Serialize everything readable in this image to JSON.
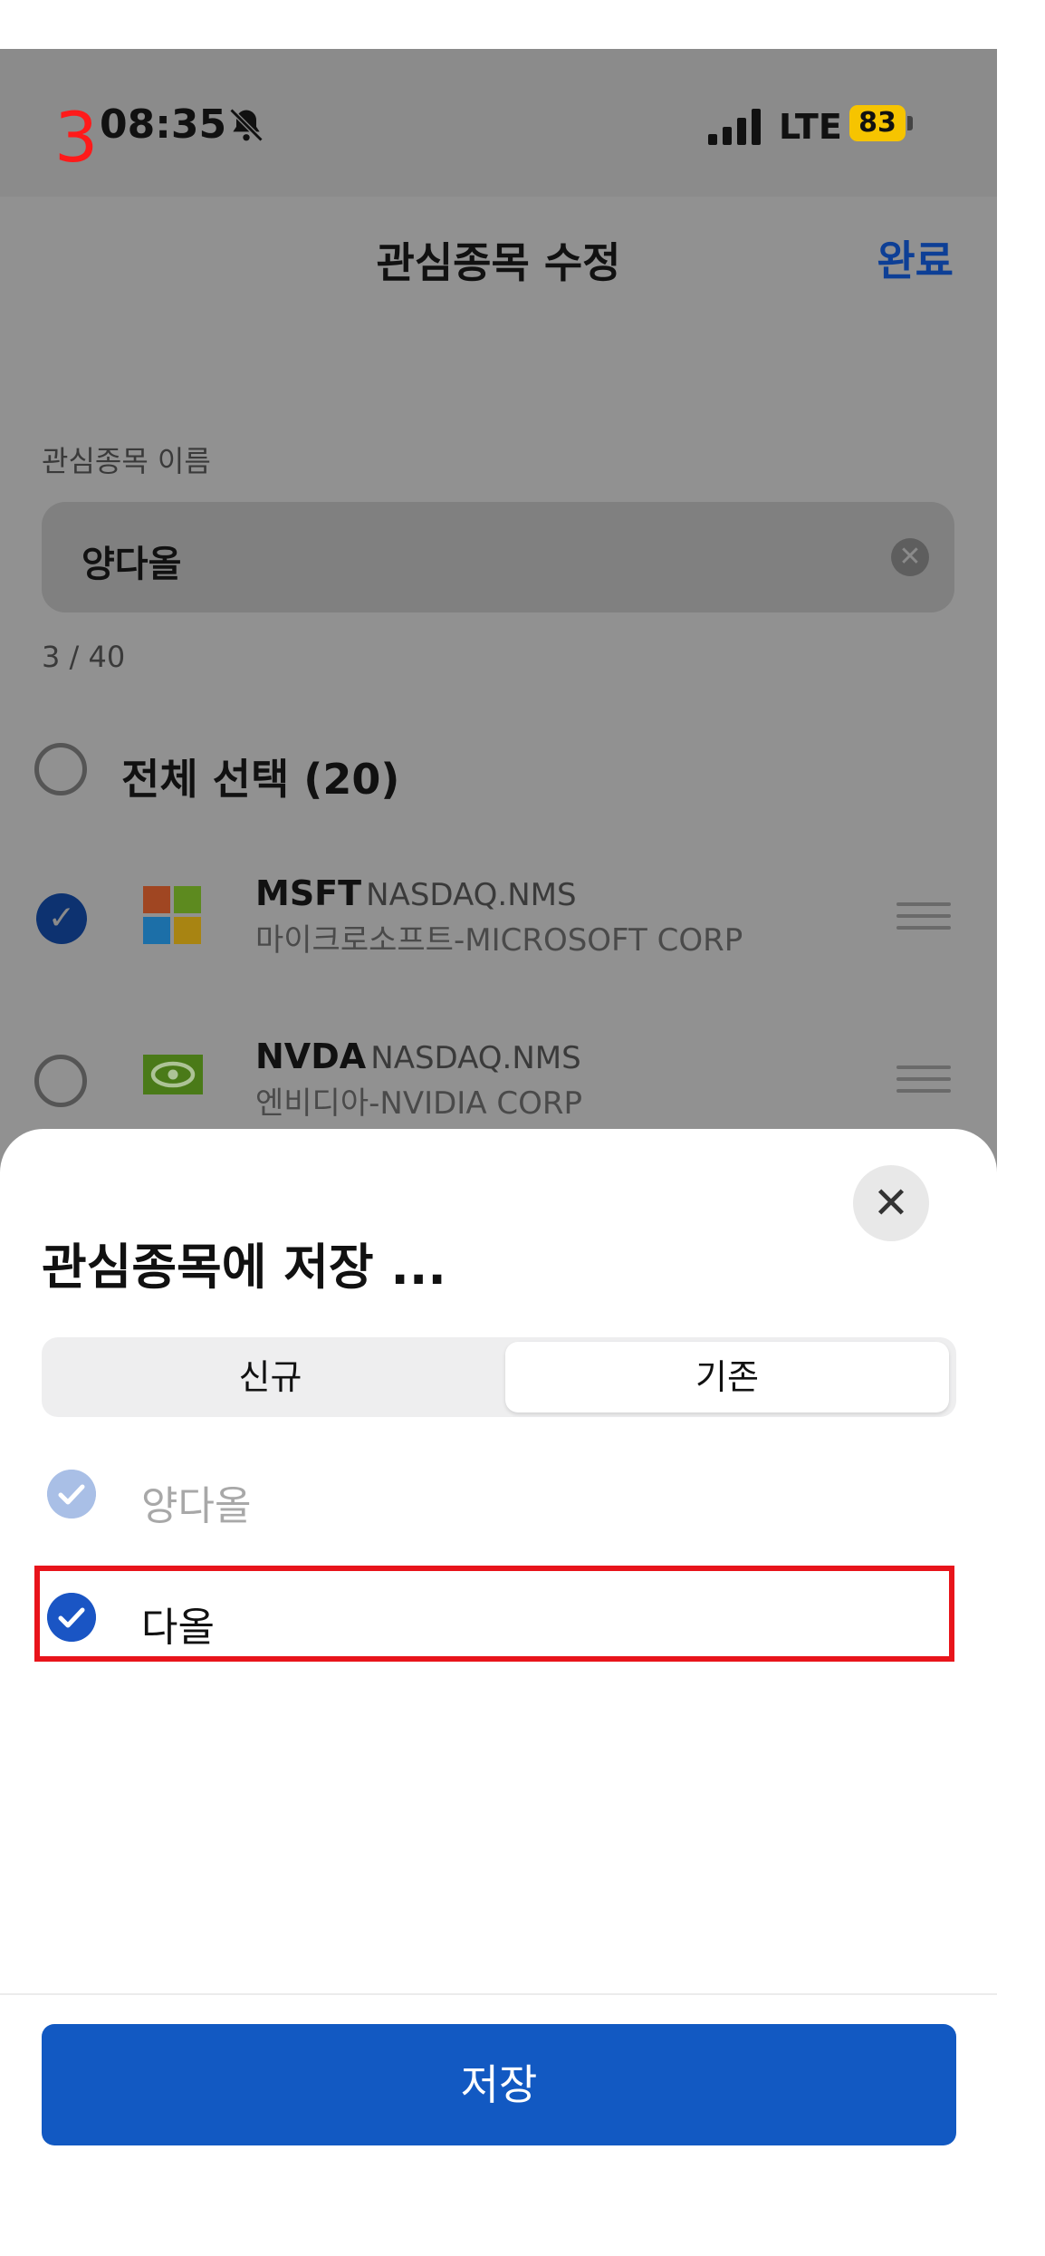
{
  "step_marker": "3",
  "status_bar": {
    "time": "08:35",
    "network": "LTE",
    "battery": "83"
  },
  "nav": {
    "title": "관심종목 수정",
    "done_label": "완료"
  },
  "name_field": {
    "label": "관심종목 이름",
    "value": "양다올",
    "clear_icon": "clear-icon",
    "char_count": "3 / 40"
  },
  "select_all": {
    "label": "전체 선택 (20)"
  },
  "stocks": [
    {
      "ticker": "MSFT",
      "exchange": "NASDAQ.NMS",
      "company": "마이크로소프트-MICROSOFT CORP",
      "checked": true,
      "logo": "microsoft-logo"
    },
    {
      "ticker": "NVDA",
      "exchange": "NASDAQ.NMS",
      "company": "엔비디아-NVIDIA CORP",
      "checked": false,
      "logo": "nvidia-logo"
    }
  ],
  "sheet": {
    "title": "관심종목에 저장 ...",
    "tabs": [
      "신규",
      "기존"
    ],
    "selected_tab": "기존",
    "options": [
      {
        "label": "양다올",
        "state": "disabled-checked"
      },
      {
        "label": "다올",
        "state": "checked"
      }
    ],
    "save_label": "저장"
  },
  "colors": {
    "primary": "#1259c2",
    "done": "#0d3f96",
    "highlight": "#e8141b",
    "battery": "#f6c400"
  }
}
